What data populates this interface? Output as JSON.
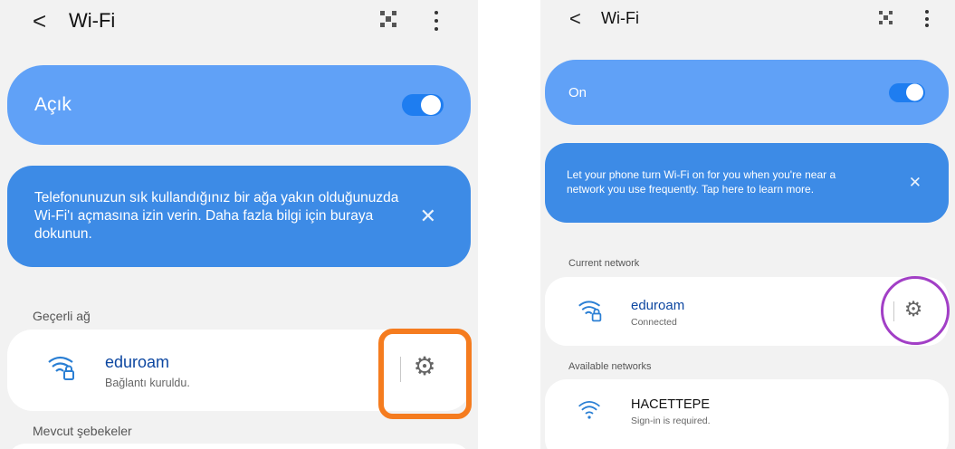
{
  "left": {
    "header": {
      "back": "<",
      "title": "Wi-Fi"
    },
    "toggle": {
      "label": "Açık",
      "state": "on"
    },
    "banner": {
      "text": "Telefonunuzun sık kullandığınız bir ağa yakın olduğunuzda Wi-Fi'ı açmasına izin verin. Daha fazla bilgi için buraya dokunun.",
      "close": "✕"
    },
    "current_section": "Geçerli ağ",
    "current_network": {
      "name": "eduroam",
      "status": "Bağlantı kuruldu."
    },
    "available_section": "Mevcut şebekeler"
  },
  "right": {
    "header": {
      "back": "<",
      "title": "Wi-Fi"
    },
    "toggle": {
      "label": "On",
      "state": "on"
    },
    "banner": {
      "text": "Let your phone turn Wi-Fi on for you when you're near a network you use frequently. Tap here to learn more.",
      "close": "✕"
    },
    "current_section": "Current network",
    "current_network": {
      "name": "eduroam",
      "status": "Connected"
    },
    "available_section": "Available networks",
    "available_network": {
      "name": "HACETTEPE",
      "status": "Sign-in is required."
    }
  },
  "icons": {
    "back": "chevron-left-icon",
    "qr": "qr-code-icon",
    "more": "more-vertical-icon",
    "wifi_lock": "wifi-lock-icon",
    "wifi": "wifi-icon",
    "settings": "gear-icon",
    "close": "close-icon"
  },
  "colors": {
    "toggle_bar": "#60a1f7",
    "banner": "#3d8be6",
    "switch": "#1e7df0",
    "network_name": "#0d47a1",
    "highlight_orange": "#f57c1f",
    "highlight_purple": "#a23fc6"
  }
}
